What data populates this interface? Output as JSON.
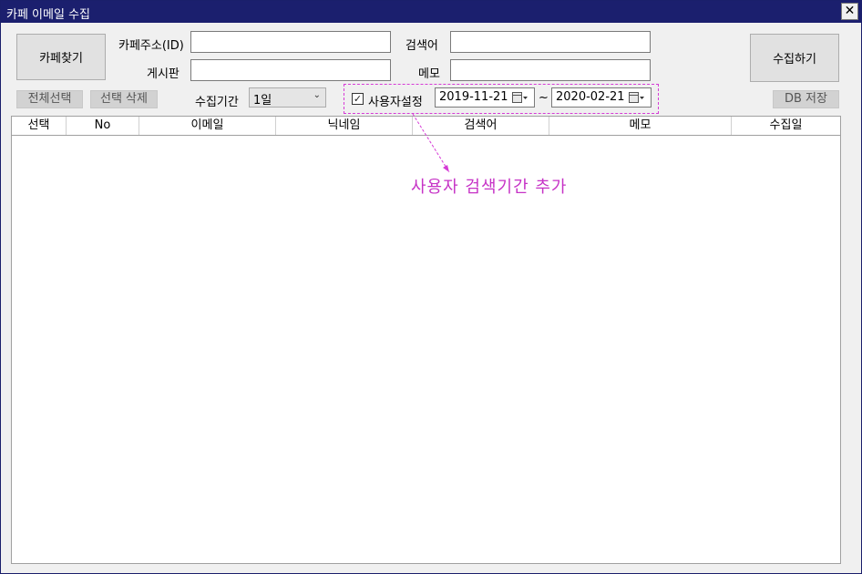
{
  "window": {
    "title": "카페 이메일 수집",
    "close_label": "✕"
  },
  "buttons": {
    "find_cafe": "카페찾기",
    "collect": "수집하기",
    "select_all": "전체선택",
    "delete_selected": "선택 삭제",
    "db_save": "DB 저장"
  },
  "form": {
    "cafe_address_label": "카페주소(ID)",
    "cafe_address_value": "",
    "board_label": "게시판",
    "board_value": "",
    "keyword_label": "검색어",
    "keyword_value": "",
    "memo_label": "메모",
    "memo_value": "",
    "period_label": "수집기간",
    "period_selected": "1일",
    "custom_label": "사용자설정",
    "custom_checked": true,
    "date_from": "2019-11-21",
    "date_sep": "~",
    "date_to": "2020-02-21"
  },
  "table": {
    "columns": [
      "선택",
      "No",
      "이메일",
      "닉네임",
      "검색어",
      "메모",
      "수집일"
    ],
    "rows": []
  },
  "annotation": {
    "text": "사용자 검색기간 추가",
    "color": "#c632c6"
  }
}
